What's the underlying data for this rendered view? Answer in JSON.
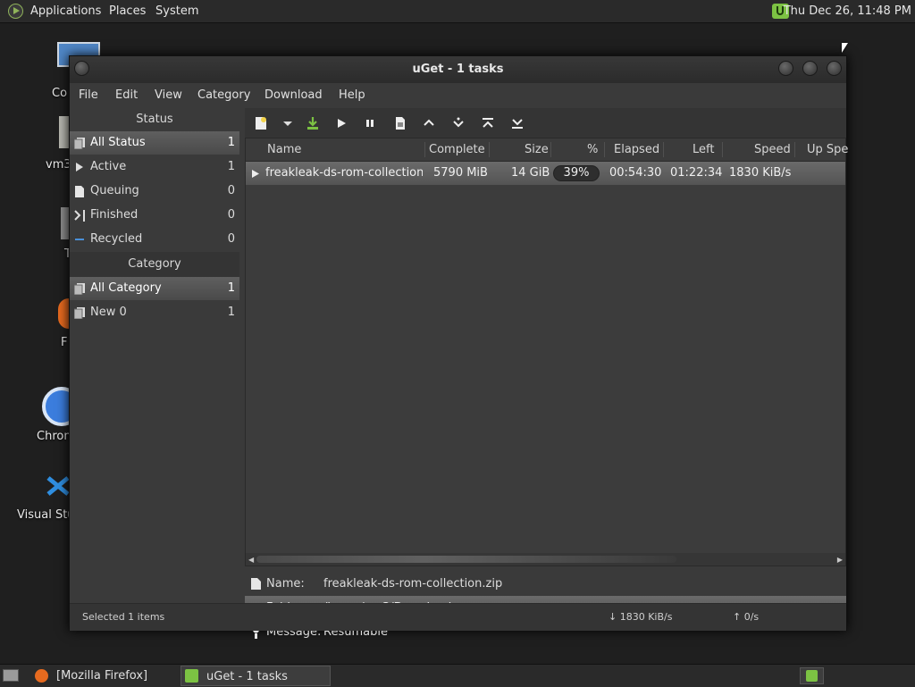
{
  "top_panel": {
    "menus": [
      "Applications",
      "Places",
      "System"
    ],
    "clock": "Thu Dec 26, 11:48 PM"
  },
  "desktop": {
    "icons": [
      {
        "label": "Co",
        "icon": "computer-icon"
      },
      {
        "label": "vm3",
        "icon": "home-folder-icon"
      },
      {
        "label": "T",
        "icon": "trash-icon"
      },
      {
        "label": "F",
        "icon": "firefox-icon"
      },
      {
        "label": "Chron",
        "icon": "chrome-icon"
      },
      {
        "label": "Visual Stu",
        "icon": "vscode-icon"
      }
    ]
  },
  "window": {
    "title": "uGet - 1 tasks",
    "menu": [
      "File",
      "Edit",
      "View",
      "Category",
      "Download",
      "Help"
    ]
  },
  "sidebar": {
    "status_header": "Status",
    "status_items": [
      {
        "label": "All Status",
        "count": "1",
        "icon": "all-status-icon"
      },
      {
        "label": "Active",
        "count": "1",
        "icon": "play-icon"
      },
      {
        "label": "Queuing",
        "count": "0",
        "icon": "document-icon"
      },
      {
        "label": "Finished",
        "count": "0",
        "icon": "finish-icon"
      },
      {
        "label": "Recycled",
        "count": "0",
        "icon": "minus-icon"
      }
    ],
    "category_header": "Category",
    "category_items": [
      {
        "label": "All Category",
        "count": "1",
        "icon": "all-category-icon"
      },
      {
        "label": "New 0",
        "count": "1",
        "icon": "category-icon"
      }
    ]
  },
  "toolbar": {
    "icons": [
      "new-download-icon",
      "dropdown-arrow-icon",
      "download-icon",
      "start-icon",
      "pause-icon",
      "properties-icon",
      "move-up-icon",
      "move-down-icon",
      "move-top-icon",
      "move-bottom-icon"
    ]
  },
  "list": {
    "columns": [
      "Name",
      "Complete",
      "Size",
      "%",
      "Elapsed",
      "Left",
      "Speed",
      "Up Spe"
    ],
    "rows": [
      {
        "name": "freakleak-ds-rom-collection.",
        "complete": "5790 MiB",
        "size": "14 GiB",
        "percent": "39%",
        "elapsed": "00:54:30",
        "left": "01:22:34",
        "speed": "1830 KiB/s",
        "progress": 0.39
      }
    ]
  },
  "details": {
    "name_label": "Name:",
    "name_value": "freakleak-ds-rom-collection.zip",
    "folder_label": "Folder:",
    "folder_value": "/home/vm3/Downloads",
    "message_label": "Message:",
    "message_value": "Resumable"
  },
  "statusbar": {
    "selected": "Selected 1 items",
    "down_speed": "↓ 1830 KiB/s",
    "up_speed": "↑ 0/s"
  },
  "taskbar": {
    "tasks": [
      "[Mozilla Firefox]",
      "uGet - 1 tasks"
    ]
  },
  "colors": {
    "accent_green": "#7cc243",
    "selection": "#5f5f5f",
    "window_bg": "#3a3a3a"
  }
}
